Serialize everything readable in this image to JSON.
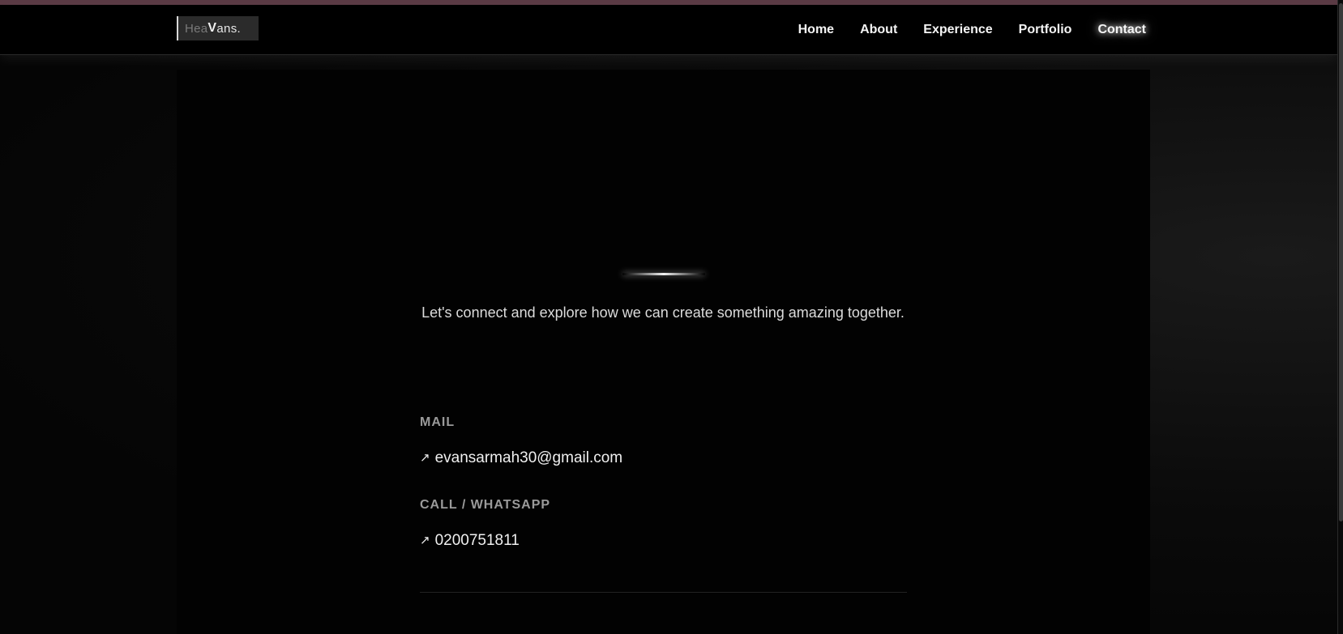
{
  "logo": {
    "part1": "Hea",
    "part2": "V",
    "part3": "ans."
  },
  "nav": {
    "items": [
      {
        "label": "Home"
      },
      {
        "label": "About"
      },
      {
        "label": "Experience"
      },
      {
        "label": "Portfolio"
      },
      {
        "label": "Contact"
      }
    ],
    "active": "Contact"
  },
  "main": {
    "tagline": "Let's connect and explore how we can create something amazing together.",
    "mail": {
      "label": "MAIL",
      "arrow": "↗",
      "value": "evansarmah30@gmail.com"
    },
    "phone": {
      "label": "CALL / WHATSAPP",
      "arrow": "↗",
      "value": "0200751811"
    }
  },
  "colors": {
    "background": "#050505",
    "accent_strip": "#5a3a44",
    "text": "#f0f0f0",
    "label": "#9a9a9a"
  }
}
